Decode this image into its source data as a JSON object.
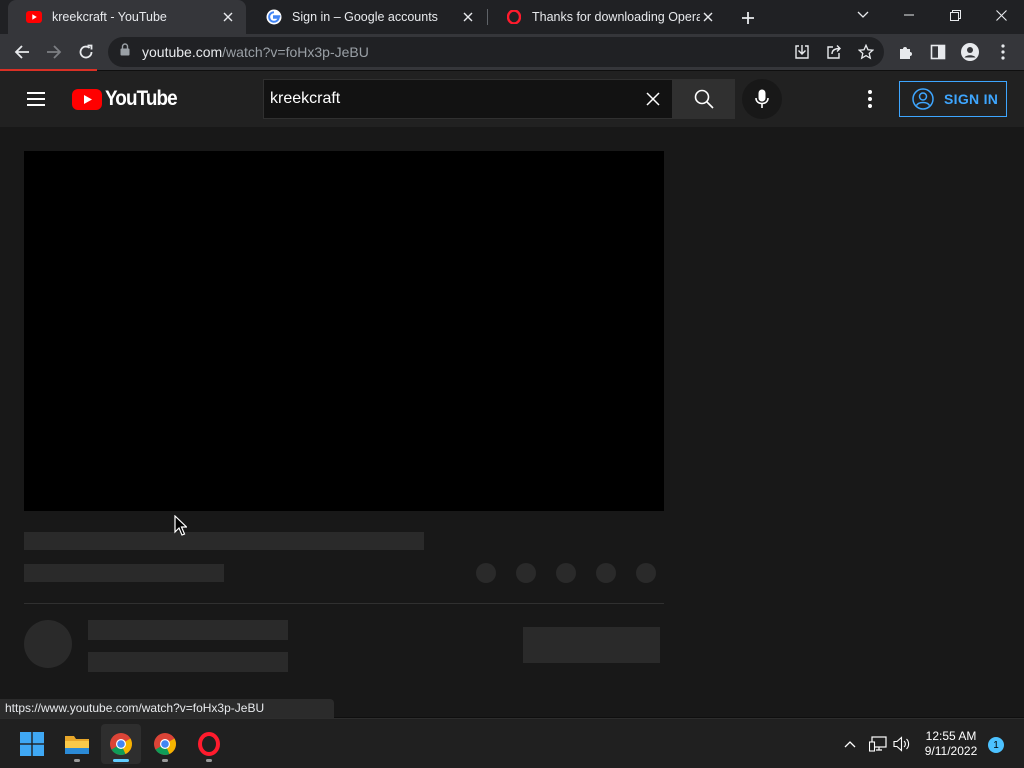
{
  "browser": {
    "tabs": [
      {
        "title": "kreekcraft - YouTube",
        "favicon": "youtube-favicon",
        "active": true
      },
      {
        "title": "Sign in – Google accounts",
        "favicon": "google-favicon",
        "active": false
      },
      {
        "title": "Thanks for downloading Opera",
        "favicon": "opera-favicon",
        "active": false
      }
    ],
    "address": {
      "host": "youtube.com",
      "path": "/watch?v=foHx3p-JeBU"
    },
    "status_url": "https://www.youtube.com/watch?v=foHx3p-JeBU"
  },
  "youtube": {
    "logo_text": "YouTube",
    "search_value": "kreekcraft",
    "signin_label": "SIGN IN",
    "accent_color": "#3ea6ff",
    "brand_red": "#ff0000"
  },
  "taskbar": {
    "time": "12:55 AM",
    "date": "9/11/2022",
    "notification_count": "1"
  }
}
